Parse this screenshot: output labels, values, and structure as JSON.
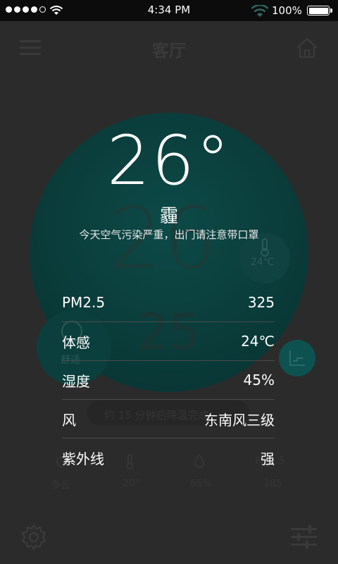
{
  "status_bar": {
    "time": "4:34 PM",
    "battery": "100%",
    "signal_dots_filled": 4,
    "signal_dots_total": 5
  },
  "background": {
    "title": "客厅",
    "big_temp": "26",
    "sub_temp": "25",
    "side_left_label": "舒适",
    "side_right_temp": "24℃",
    "banner": "约 15 分钟后降温完成",
    "metrics": [
      {
        "label": "多云",
        "icon": "cloud-icon"
      },
      {
        "label": "20°",
        "icon": "thermometer-icon"
      },
      {
        "label": "65%",
        "icon": "drop-icon"
      },
      {
        "label": "185",
        "title": "PM2.5"
      }
    ]
  },
  "overlay": {
    "temperature": "26°",
    "condition": "霾",
    "tip": "今天空气污染严重，出门请注意带口罩",
    "rows": [
      {
        "label": "PM2.5",
        "value": "325"
      },
      {
        "label": "体感",
        "value": "24℃"
      },
      {
        "label": "湿度",
        "value": "45%"
      },
      {
        "label": "风",
        "value": "东南风三级"
      },
      {
        "label": "紫外线",
        "value": "强"
      }
    ]
  },
  "colors": {
    "overlay_bg": "#1b1b1b",
    "teal_circle": "#0a3c3a"
  }
}
